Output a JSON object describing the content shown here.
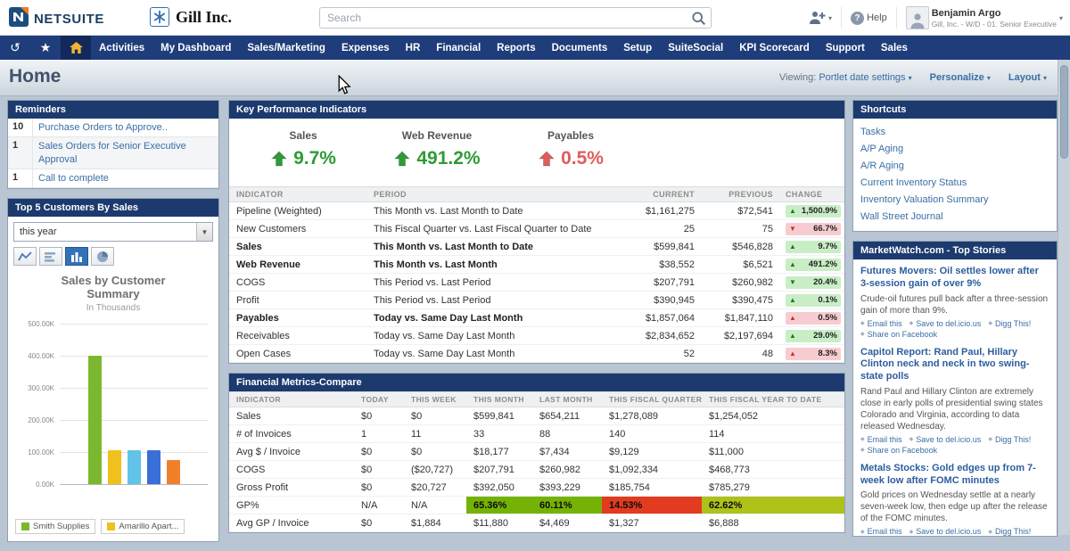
{
  "theme": {
    "navy": "#1c3a6e",
    "nav_blue": "#1f3d7a",
    "link_blue": "#3a6ea5",
    "headline_blue": "#2b5e9e",
    "good_green": "#2f9b35",
    "bad_red": "#e05c5c",
    "badge_good_bg": "#c9eec6",
    "badge_bad_bg": "#f7ccd0",
    "page_bg": "#b9c5d2"
  },
  "header": {
    "brand": "NETSUITE",
    "company": "Gill Inc.",
    "search_placeholder": "Search",
    "help_label": "Help",
    "user_name": "Benjamin Argo",
    "user_role": "Gill, Inc. - W/D - 01. Senior Executive"
  },
  "nav": {
    "items": [
      "Activities",
      "My Dashboard",
      "Sales/Marketing",
      "Expenses",
      "HR",
      "Financial",
      "Reports",
      "Documents",
      "Setup",
      "SuiteSocial",
      "KPI Scorecard",
      "Support",
      "Sales"
    ]
  },
  "page": {
    "title": "Home",
    "viewing_prefix": "Viewing:",
    "viewing_value": "Portlet date settings",
    "personalize": "Personalize",
    "layout": "Layout"
  },
  "reminders": {
    "title": "Reminders",
    "items": [
      {
        "count": "10",
        "label": "Purchase Orders to Approve.."
      },
      {
        "count": "1",
        "label": "Sales Orders for Senior Executive Approval"
      },
      {
        "count": "1",
        "label": "Call to complete"
      }
    ]
  },
  "top_customers": {
    "title": "Top 5 Customers By Sales",
    "period_value": "this year",
    "chart_types": [
      "line",
      "horizontal-bar",
      "vertical-bar",
      "pie"
    ],
    "selected_chart_type": "vertical-bar"
  },
  "chart_data": {
    "type": "bar",
    "title": "Sales by Customer Summary",
    "subtitle": "In Thousands",
    "categories": [
      "Smith Supplies",
      "Amarillo Apart...",
      "",
      "",
      ""
    ],
    "values": [
      400,
      105,
      105,
      105,
      75
    ],
    "unit": "K",
    "ylim": [
      0,
      500
    ],
    "y_ticks": [
      "500.00K",
      "400.00K",
      "300.00K",
      "200.00K",
      "100.00K",
      "0.00K"
    ],
    "colors": [
      "#7cb82f",
      "#f0c01c",
      "#62c3e8",
      "#3a6fd8",
      "#f0802a"
    ],
    "legend": [
      {
        "label": "Smith Supplies",
        "color": "#7cb82f"
      },
      {
        "label": "Amarillo Apart...",
        "color": "#f0c01c"
      }
    ],
    "legend_position": "bottom",
    "grid": true
  },
  "kpi": {
    "title": "Key Performance Indicators",
    "summary": [
      {
        "label": "Sales",
        "value": "9.7%",
        "direction": "up",
        "tone": "good"
      },
      {
        "label": "Web Revenue",
        "value": "491.2%",
        "direction": "up",
        "tone": "good"
      },
      {
        "label": "Payables",
        "value": "0.5%",
        "direction": "up",
        "tone": "bad"
      }
    ],
    "columns": [
      "INDICATOR",
      "PERIOD",
      "CURRENT",
      "PREVIOUS",
      "CHANGE"
    ],
    "rows": [
      {
        "indicator": "Pipeline (Weighted)",
        "period": "This Month vs. Last Month to Date",
        "current": "$1,161,275",
        "previous": "$72,541",
        "change": "1,500.9%",
        "direction": "up",
        "tone": "good",
        "bold": false
      },
      {
        "indicator": "New Customers",
        "period": "This Fiscal Quarter vs. Last Fiscal Quarter to Date",
        "current": "25",
        "previous": "75",
        "change": "66.7%",
        "direction": "down",
        "tone": "bad",
        "bold": false
      },
      {
        "indicator": "Sales",
        "period": "This Month vs. Last Month to Date",
        "current": "$599,841",
        "previous": "$546,828",
        "change": "9.7%",
        "direction": "up",
        "tone": "good",
        "bold": true
      },
      {
        "indicator": "Web Revenue",
        "period": "This Month vs. Last Month",
        "current": "$38,552",
        "previous": "$6,521",
        "change": "491.2%",
        "direction": "up",
        "tone": "good",
        "bold": true
      },
      {
        "indicator": "COGS",
        "period": "This Period vs. Last Period",
        "current": "$207,791",
        "previous": "$260,982",
        "change": "20.4%",
        "direction": "down",
        "tone": "good",
        "bold": false
      },
      {
        "indicator": "Profit",
        "period": "This Period vs. Last Period",
        "current": "$390,945",
        "previous": "$390,475",
        "change": "0.1%",
        "direction": "up",
        "tone": "good",
        "bold": false
      },
      {
        "indicator": "Payables",
        "period": "Today vs. Same Day Last Month",
        "current": "$1,857,064",
        "previous": "$1,847,110",
        "change": "0.5%",
        "direction": "up",
        "tone": "bad",
        "bold": true
      },
      {
        "indicator": "Receivables",
        "period": "Today vs. Same Day Last Month",
        "current": "$2,834,652",
        "previous": "$2,197,694",
        "change": "29.0%",
        "direction": "up",
        "tone": "good",
        "bold": false
      },
      {
        "indicator": "Open Cases",
        "period": "Today vs. Same Day Last Month",
        "current": "52",
        "previous": "48",
        "change": "8.3%",
        "direction": "up",
        "tone": "bad",
        "bold": false
      }
    ]
  },
  "financial_metrics": {
    "title": "Financial Metrics-Compare",
    "columns": [
      "INDICATOR",
      "TODAY",
      "THIS WEEK",
      "THIS MONTH",
      "LAST MONTH",
      "THIS FISCAL QUARTER",
      "THIS FISCAL YEAR TO DATE"
    ],
    "rows": [
      {
        "cells": [
          "Sales",
          "$0",
          "$0",
          "$599,841",
          "$654,211",
          "$1,278,089",
          "$1,254,052"
        ]
      },
      {
        "cells": [
          "# of Invoices",
          "1",
          "11",
          "33",
          "88",
          "140",
          "114"
        ]
      },
      {
        "cells": [
          "Avg $ / Invoice",
          "$0",
          "$0",
          "$18,177",
          "$7,434",
          "$9,129",
          "$11,000"
        ]
      },
      {
        "cells": [
          "COGS",
          "$0",
          "($20,727)",
          "$207,791",
          "$260,982",
          "$1,092,334",
          "$468,773"
        ]
      },
      {
        "cells": [
          "Gross Profit",
          "$0",
          "$20,727",
          "$392,050",
          "$393,229",
          "$185,754",
          "$785,279"
        ]
      },
      {
        "cells": [
          "GP%",
          "N/A",
          "N/A",
          "65.36%",
          "60.11%",
          "14.53%",
          "62.62%"
        ],
        "highlights": {
          "3": "#74b306",
          "4": "#74b306",
          "5": "#e23b20",
          "6": "#aec21a"
        }
      },
      {
        "cells": [
          "Avg GP / Invoice",
          "$0",
          "$1,884",
          "$11,880",
          "$4,469",
          "$1,327",
          "$6,888"
        ]
      }
    ]
  },
  "shortcuts": {
    "title": "Shortcuts",
    "items": [
      "Tasks",
      "A/P Aging",
      "A/R Aging",
      "Current Inventory Status",
      "Inventory Valuation Summary",
      "Wall Street Journal"
    ]
  },
  "marketwatch": {
    "title": "MarketWatch.com - Top Stories",
    "stories": [
      {
        "headline": "Futures Movers: Oil settles lower after 3-session gain of over 9%",
        "body": "Crude-oil futures pull back after a three-session gain of more than 9%.",
        "links": [
          "Email this",
          "Save to del.icio.us",
          "Digg This!",
          "Share on Facebook"
        ]
      },
      {
        "headline": "Capitol Report: Rand Paul, Hillary Clinton neck and neck in two swing-state polls",
        "body": "Rand Paul and Hillary Clinton are extremely close in early polls of presidential swing states Colorado and Virginia, according to data released Wednesday.",
        "links": [
          "Email this",
          "Save to del.icio.us",
          "Digg This!",
          "Share on Facebook"
        ]
      },
      {
        "headline": "Metals Stocks: Gold edges up from 7-week low after FOMC minutes",
        "body": "Gold prices on Wednesday settle at a nearly seven-week low, then edge up after the release of the FOMC minutes.",
        "links": [
          "Email this",
          "Save to del.icio.us",
          "Digg This!"
        ]
      }
    ]
  }
}
